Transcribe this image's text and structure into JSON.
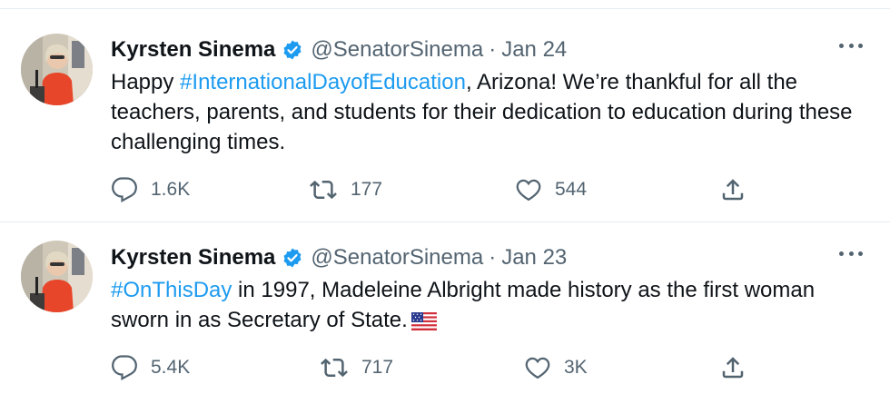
{
  "tweets": [
    {
      "author_name": "Kyrsten Sinema",
      "handle": "@SenatorSinema",
      "separator": "·",
      "date": "Jan 24",
      "text_before": "Happy ",
      "hashtag": "#InternationalDayofEducation",
      "text_after": ", Arizona! We’re thankful for all the teachers, parents, and students for their dedication to education during these challenging times.",
      "replies": "1.6K",
      "retweets": "177",
      "likes": "544"
    },
    {
      "author_name": "Kyrsten Sinema",
      "handle": "@SenatorSinema",
      "separator": "·",
      "date": "Jan 23",
      "text_before": "",
      "hashtag": "#OnThisDay",
      "text_after": " in 1997, Madeleine Albright made history as the first woman sworn in as Secretary of State.",
      "emoji": "us-flag",
      "replies": "5.4K",
      "retweets": "717",
      "likes": "3K"
    }
  ],
  "colors": {
    "link": "#1d9bf0",
    "verified": "#1d9bf0",
    "secondary_text": "#536471",
    "divider": "#e6ecf0"
  },
  "icons": [
    "verified-badge-icon",
    "more-icon",
    "reply-icon",
    "retweet-icon",
    "like-icon",
    "share-icon",
    "us-flag-emoji"
  ]
}
